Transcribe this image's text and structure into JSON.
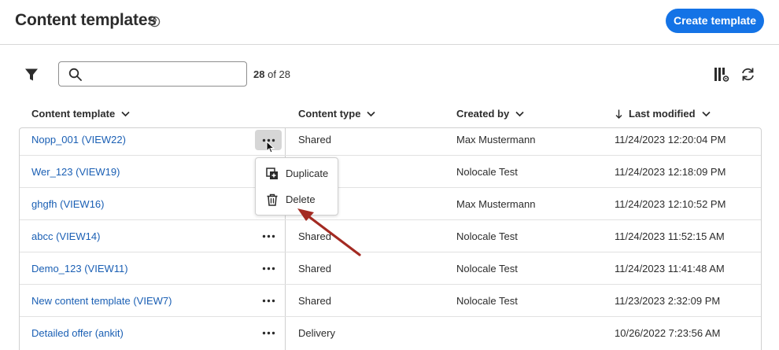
{
  "header": {
    "title": "Content templates",
    "create_button": "Create template"
  },
  "toolbar": {
    "search_placeholder": "",
    "search_value": "",
    "count_shown": "28",
    "count_of": "of 28"
  },
  "columns": {
    "name": "Content template",
    "type": "Content type",
    "created_by": "Created by",
    "last_modified": "Last modified"
  },
  "rows": [
    {
      "name": "Nopp_001 (VIEW22)",
      "type": "Shared",
      "created_by": "Max Mustermann",
      "modified": "11/24/2023 12:20:04 PM"
    },
    {
      "name": "Wer_123 (VIEW19)",
      "type": "",
      "created_by": "Nolocale Test",
      "modified": "11/24/2023 12:18:09 PM"
    },
    {
      "name": "ghgfh (VIEW16)",
      "type": "",
      "created_by": "Max Mustermann",
      "modified": "11/24/2023 12:10:52 PM"
    },
    {
      "name": "abcc (VIEW14)",
      "type": "Shared",
      "created_by": "Nolocale Test",
      "modified": "11/24/2023 11:52:15 AM"
    },
    {
      "name": "Demo_123 (VIEW11)",
      "type": "Shared",
      "created_by": "Nolocale Test",
      "modified": "11/24/2023 11:41:48 AM"
    },
    {
      "name": "New content template (VIEW7)",
      "type": "Shared",
      "created_by": "Nolocale Test",
      "modified": "11/23/2023 2:32:09 PM"
    },
    {
      "name": "Detailed offer (ankit)",
      "type": "Delivery",
      "created_by": "",
      "modified": "10/26/2022 7:23:56 AM"
    }
  ],
  "context_menu": {
    "duplicate": "Duplicate",
    "delete": "Delete"
  },
  "colors": {
    "accent": "#1473e6",
    "link": "#1a5fb4",
    "annotation_arrow": "#a32a22"
  }
}
